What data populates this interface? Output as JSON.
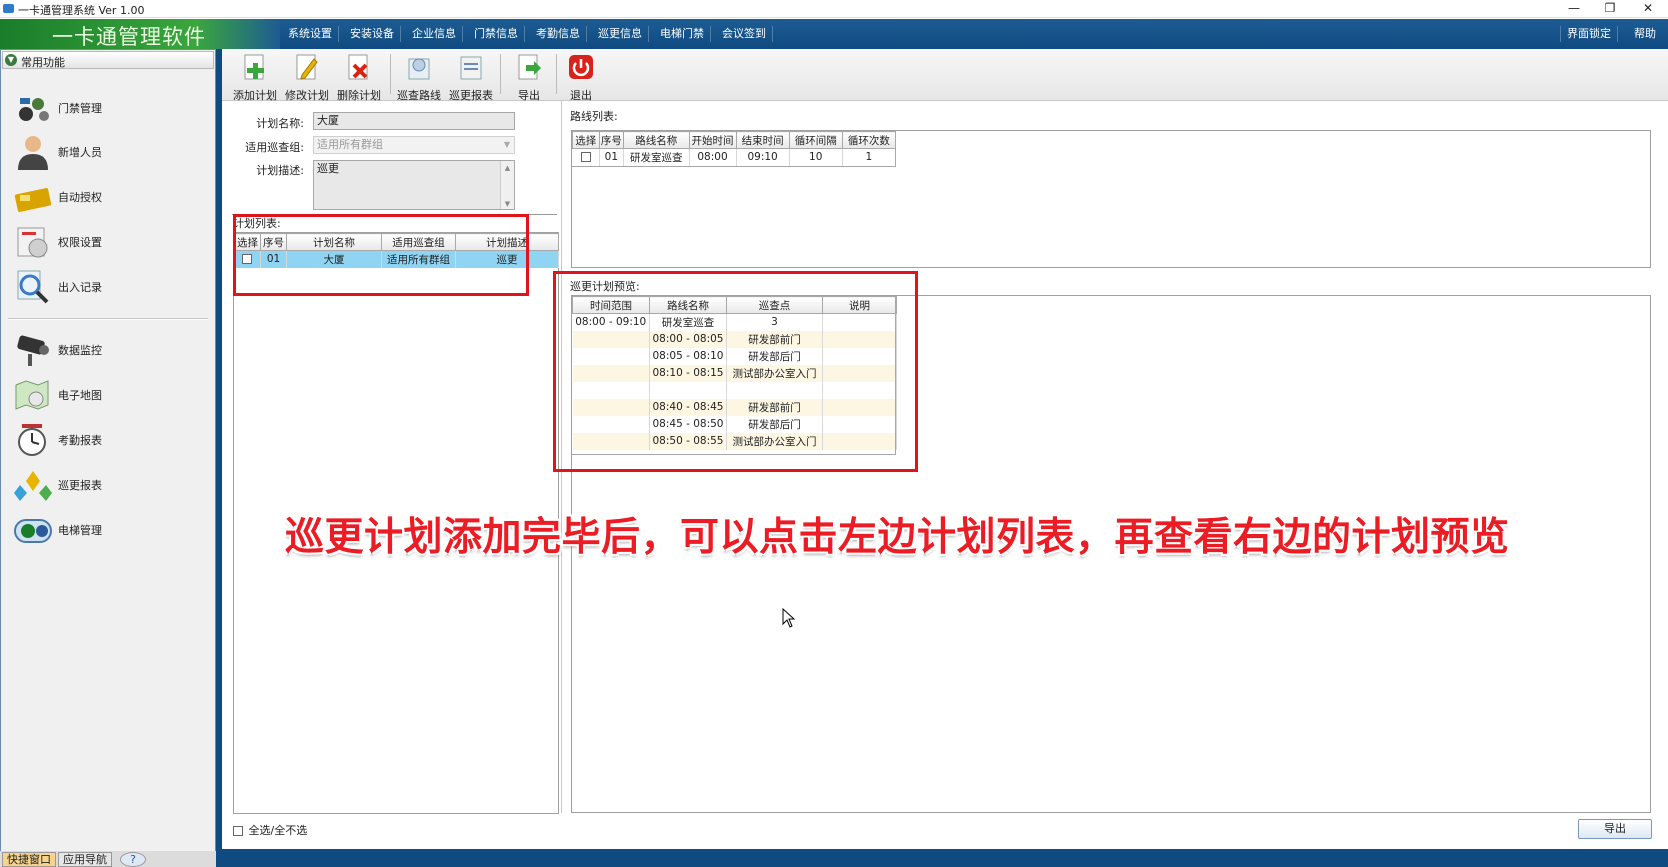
{
  "window": {
    "title": "一卡通管理系统  Ver 1.00",
    "minimize": "—",
    "restore": "❐",
    "close": "✕"
  },
  "brand": "一卡通管理软件",
  "menu": [
    "系统设置",
    "安装设备",
    "企业信息",
    "门禁信息",
    "考勤信息",
    "巡更信息",
    "电梯门禁",
    "会议签到"
  ],
  "menu_right": [
    "界面锁定",
    "帮助"
  ],
  "sidebar": {
    "header": "常用功能",
    "items": [
      "门禁管理",
      "新增人员",
      "自动授权",
      "权限设置",
      "出入记录",
      "数据监控",
      "电子地图",
      "考勤报表",
      "巡更报表",
      "电梯管理"
    ],
    "tabs": [
      "快捷窗口",
      "应用导航",
      "?"
    ]
  },
  "toolbar": [
    "添加计划",
    "修改计划",
    "删除计划",
    "巡查路线",
    "巡更报表",
    "导出",
    "退出"
  ],
  "form": {
    "name_label": "计划名称:",
    "name_value": "大厦",
    "group_label": "适用巡查组:",
    "group_value": "适用所有群组",
    "desc_label": "计划描述:",
    "desc_value": "巡更"
  },
  "plan_list": {
    "title": "计划列表:",
    "headers": [
      "选择",
      "序号",
      "计划名称",
      "适用巡查组",
      "计划描述"
    ],
    "rows": [
      [
        "",
        "01",
        "大厦",
        "适用所有群组",
        "巡更"
      ]
    ]
  },
  "route_list": {
    "title": "路线列表:",
    "headers": [
      "选择",
      "序号",
      "路线名称",
      "开始时间",
      "结束时间",
      "循环间隔",
      "循环次数"
    ],
    "rows": [
      [
        "",
        "01",
        "研发室巡查",
        "08:00",
        "09:10",
        "10",
        "1"
      ]
    ]
  },
  "preview": {
    "title": "巡更计划预览:",
    "headers": [
      "时间范围",
      "路线名称",
      "巡查点",
      "说明"
    ],
    "rows": [
      [
        "08:00 - 09:10",
        "研发室巡查",
        "3",
        ""
      ],
      [
        "",
        "08:00 - 08:05",
        "研发部前门",
        ""
      ],
      [
        "",
        "08:05 - 08:10",
        "研发部后门",
        ""
      ],
      [
        "",
        "08:10 - 08:15",
        "测试部办公室入门",
        ""
      ],
      [
        "",
        "",
        "",
        ""
      ],
      [
        "",
        "08:40 - 08:45",
        "研发部前门",
        ""
      ],
      [
        "",
        "08:45 - 08:50",
        "研发部后门",
        ""
      ],
      [
        "",
        "08:50 - 08:55",
        "测试部办公室入门",
        ""
      ]
    ]
  },
  "select_all": "全选/全不选",
  "export_button": "导出",
  "caption": "巡更计划添加完毕后，可以点击左边计划列表，再查看右边的计划预览",
  "colors": {
    "accent_red": "#ec1c24",
    "menubar": "#1d5c93",
    "selection": "#8fd4f2"
  }
}
